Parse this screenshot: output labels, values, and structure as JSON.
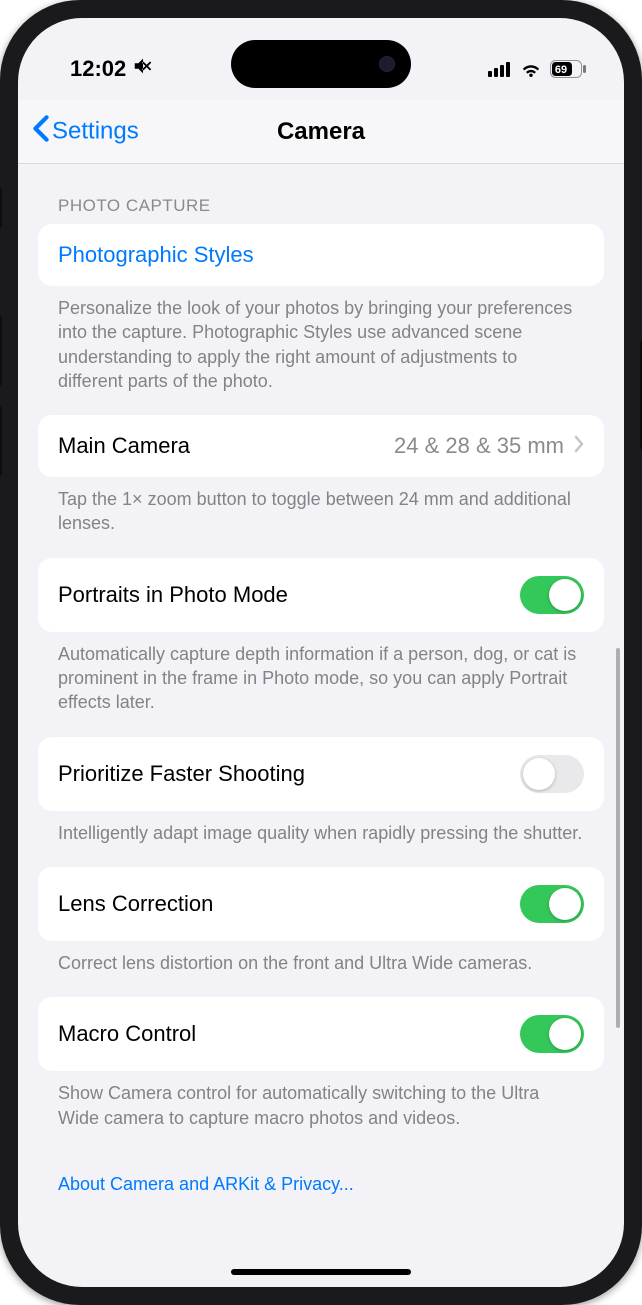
{
  "status": {
    "time": "12:02",
    "battery": "69"
  },
  "nav": {
    "back": "Settings",
    "title": "Camera"
  },
  "section": {
    "header": "PHOTO CAPTURE"
  },
  "rows": {
    "styles": {
      "label": "Photographic Styles",
      "footer": "Personalize the look of your photos by bringing your preferences into the capture. Photographic Styles use advanced scene understanding to apply the right amount of adjustments to different parts of the photo."
    },
    "mainCamera": {
      "label": "Main Camera",
      "value": "24 & 28 & 35 mm",
      "footer": "Tap the 1× zoom button to toggle between 24 mm and additional lenses."
    },
    "portraits": {
      "label": "Portraits in Photo Mode",
      "on": true,
      "footer": "Automatically capture depth information if a person, dog, or cat is prominent in the frame in Photo mode, so you can apply Portrait effects later."
    },
    "prioritize": {
      "label": "Prioritize Faster Shooting",
      "on": false,
      "footer": "Intelligently adapt image quality when rapidly pressing the shutter."
    },
    "lens": {
      "label": "Lens Correction",
      "on": true,
      "footer": "Correct lens distortion on the front and Ultra Wide cameras."
    },
    "macro": {
      "label": "Macro Control",
      "on": true,
      "footer": "Show Camera control for automatically switching to the Ultra Wide camera to capture macro photos and videos."
    },
    "about": "About Camera and ARKit & Privacy..."
  }
}
